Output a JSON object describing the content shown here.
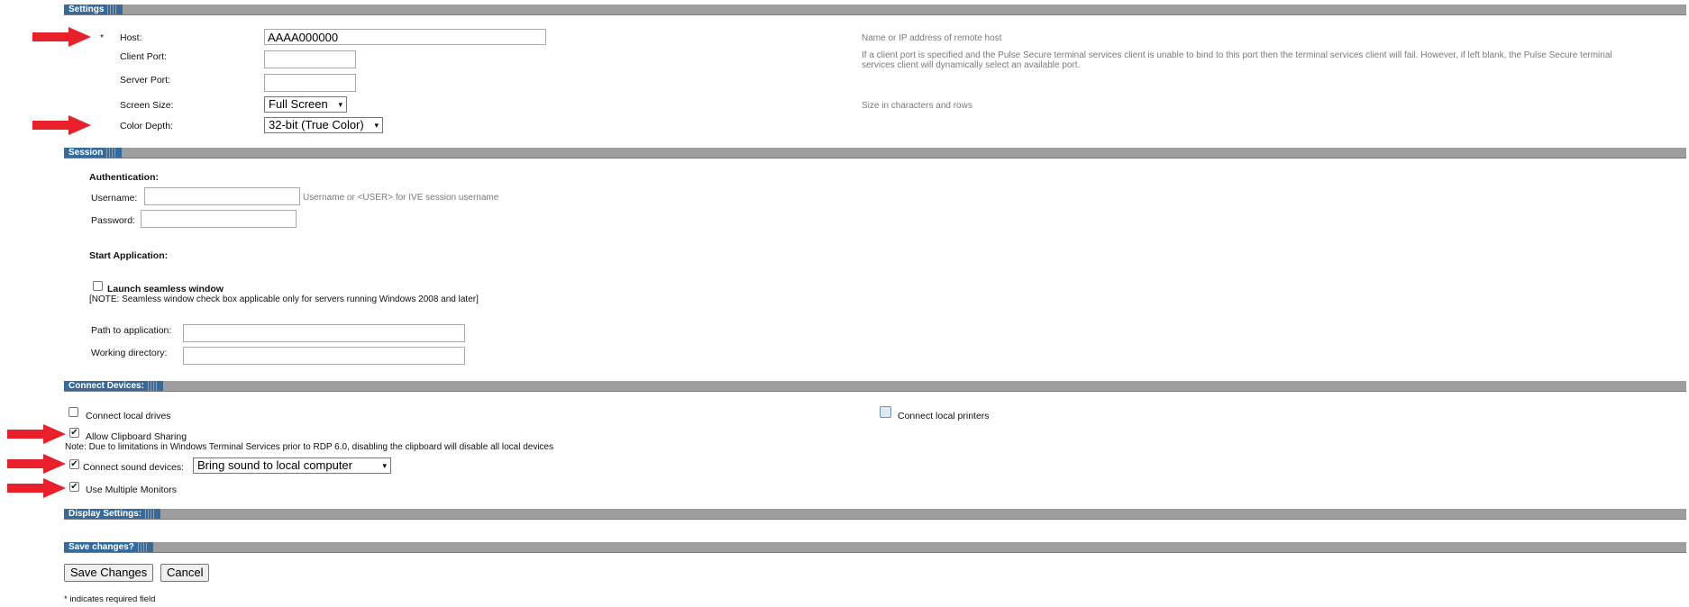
{
  "sections": {
    "settings": "Settings",
    "session": "Session",
    "connect_devices": "Connect Devices:",
    "display_settings": "Display Settings:",
    "save_changes": "Save changes?"
  },
  "settings": {
    "required_star": "*",
    "host_label": "Host:",
    "host_value": "AAAA000000",
    "host_hint": "Name or IP address of remote host",
    "client_port_label": "Client Port:",
    "client_port_value": "",
    "client_port_hint_line1": "If a client port is specified and the Pulse Secure terminal services client is unable to bind to this port then the terminal services client will fail. However, if left blank, the Pulse Secure terminal",
    "client_port_hint_line2": "services client will dynamically select an available port.",
    "server_port_label": "Server Port:",
    "server_port_value": "",
    "screen_size_label": "Screen Size:",
    "screen_size_value": "Full Screen",
    "screen_size_hint": "Size in characters and rows",
    "color_depth_label": "Color Depth:",
    "color_depth_value": "32-bit (True Color)"
  },
  "session": {
    "auth_heading": "Authentication:",
    "username_label": "Username:",
    "username_value": "",
    "username_hint": "Username or <USER> for IVE session username",
    "password_label": "Password:",
    "password_value": "",
    "start_app_heading": "Start Application:",
    "seamless_label": "Launch seamless window",
    "seamless_checked": false,
    "seamless_note": "[NOTE: Seamless window check box applicable only for servers running Windows 2008 and later]",
    "path_label": "Path to application:",
    "path_value": "",
    "workdir_label": "Working directory:",
    "workdir_value": ""
  },
  "devices": {
    "local_drives_label": "Connect local drives",
    "local_drives_checked": false,
    "local_printers_label": "Connect local printers",
    "local_printers_checked": false,
    "clipboard_label": "Allow Clipboard Sharing",
    "clipboard_checked": true,
    "clipboard_note": "Note: Due to limitations in Windows Terminal Services prior to RDP 6.0, disabling the clipboard will disable all local devices",
    "sound_label": "Connect sound devices:",
    "sound_checked": true,
    "sound_value": "Bring sound to local computer",
    "monitors_label": "Use Multiple Monitors",
    "monitors_checked": true
  },
  "actions": {
    "save_label": "Save Changes",
    "cancel_label": "Cancel",
    "required_note": "* indicates required field"
  },
  "colors": {
    "section_tab": "#356a9c",
    "section_bar": "#9e9e9e",
    "annotation_arrow": "#e8202a"
  },
  "check_glyph": "✔",
  "arrow_glyph": "▾"
}
